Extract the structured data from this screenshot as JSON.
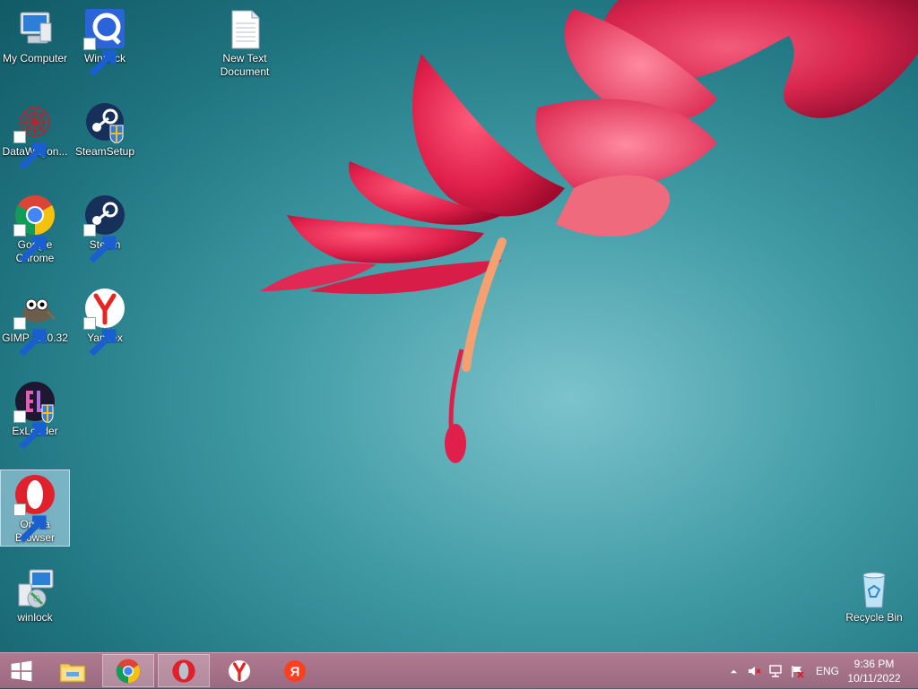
{
  "desktop": {
    "icons": [
      {
        "label": "My Computer"
      },
      {
        "label": "WinLock"
      },
      {
        "label": "New Text Document"
      },
      {
        "label": "DataWagon..."
      },
      {
        "label": "SteamSetup"
      },
      {
        "label": "Google Chrome"
      },
      {
        "label": "Steam"
      },
      {
        "label": "GIMP 2.10.32"
      },
      {
        "label": "Yandex"
      },
      {
        "label": "ExLoader"
      },
      {
        "label": "Opera Browser"
      },
      {
        "label": "winlock"
      },
      {
        "label": "Recycle Bin"
      }
    ]
  },
  "taskbar": {
    "start_icon": "windows-logo-icon",
    "pinned": [
      "file-explorer-icon",
      "chrome-icon",
      "opera-icon",
      "yandex-browser-icon",
      "yandex-icon"
    ],
    "active": "opera-icon"
  },
  "tray": {
    "language": "ENG",
    "time": "9:36 PM",
    "date": "10/11/2022"
  },
  "colors": {
    "taskbar": "#a6708a",
    "opera_red": "#e0202b",
    "chrome_red": "#db4437",
    "chrome_yellow": "#f4c20d",
    "chrome_green": "#0f9d58",
    "chrome_blue": "#4285f4"
  }
}
